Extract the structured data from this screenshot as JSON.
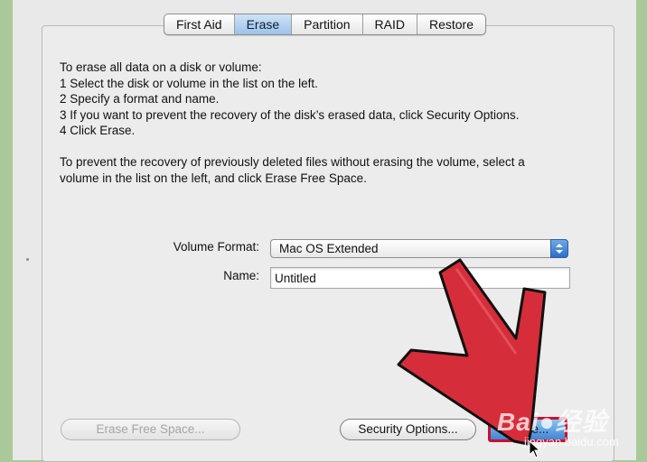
{
  "tabs": [
    {
      "label": "First Aid",
      "selected": false
    },
    {
      "label": "Erase",
      "selected": true
    },
    {
      "label": "Partition",
      "selected": false
    },
    {
      "label": "RAID",
      "selected": false
    },
    {
      "label": "Restore",
      "selected": false
    }
  ],
  "instructions": {
    "intro": "To erase all data on a disk or volume:",
    "steps": [
      "1 Select the disk or volume in the list on the left.",
      "2 Specify a format and name.",
      "3 If you want to prevent the recovery of the disk’s erased data, click Security Options.",
      "4 Click Erase."
    ],
    "free_space_line1": "To prevent the recovery of previously deleted files without erasing the volume, select a",
    "free_space_line2": "volume in the list on the left, and click Erase Free Space."
  },
  "form": {
    "format_label": "Volume Format:",
    "format_value": "Mac OS Extended",
    "name_label": "Name:",
    "name_value": "Untitled"
  },
  "buttons": {
    "erase_free_space": "Erase Free Space...",
    "security_options": "Security Options...",
    "erase": "Erase..."
  },
  "watermark": {
    "brand": "Bai●经验",
    "url": "jingyan.baidu.com"
  },
  "colors": {
    "highlight_red": "#c8102e",
    "arrow_red": "#d62d3a",
    "accent_blue": "#3f86d6",
    "background_green": "#a9c99a"
  },
  "icons": {
    "stepper": "up-down-stepper-icon",
    "arrow": "red-pointer-arrow-icon",
    "cursor": "mouse-cursor-icon"
  }
}
